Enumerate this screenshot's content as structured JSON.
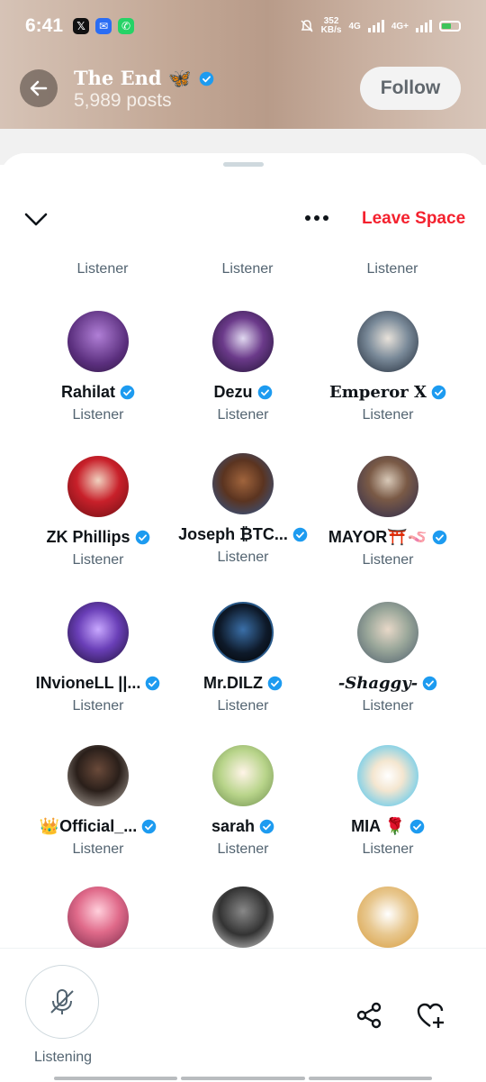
{
  "status": {
    "time": "6:41",
    "speed_value": "352",
    "speed_unit": "KB/s",
    "net1": "4G",
    "net2": "4G+"
  },
  "header": {
    "title": "The End 🦋",
    "posts": "5,989 posts",
    "follow_label": "Follow"
  },
  "space": {
    "leave_label": "Leave Space",
    "partial_roles": [
      "Listener",
      "Listener",
      "Listener"
    ]
  },
  "listeners": [
    {
      "name": "Rahilat",
      "role": "Listener",
      "verified": true
    },
    {
      "name": "Dezu",
      "role": "Listener",
      "verified": true
    },
    {
      "name": "Emperor X",
      "role": "Listener",
      "verified": true
    },
    {
      "name": "ZK Phillips",
      "role": "Listener",
      "verified": true
    },
    {
      "name": "Joseph ₿TC...",
      "role": "Listener",
      "verified": true
    },
    {
      "name": "MAYOR⛩️🪱",
      "role": "Listener",
      "verified": true
    },
    {
      "name": "INvioneLL ||...",
      "role": "Listener",
      "verified": true
    },
    {
      "name": "Mr.DILZ",
      "role": "Listener",
      "verified": true
    },
    {
      "name": "-Shaggy-",
      "role": "Listener",
      "verified": true
    },
    {
      "name": "👑Official_...",
      "role": "Listener",
      "verified": true
    },
    {
      "name": "sarah",
      "role": "Listener",
      "verified": true
    },
    {
      "name": "MIA 🌹",
      "role": "Listener",
      "verified": true
    }
  ],
  "bottom": {
    "listening_label": "Listening"
  },
  "colors": {
    "accent_red": "#f4212e",
    "verified_blue": "#1d9bf0",
    "muted_text": "#536471"
  }
}
